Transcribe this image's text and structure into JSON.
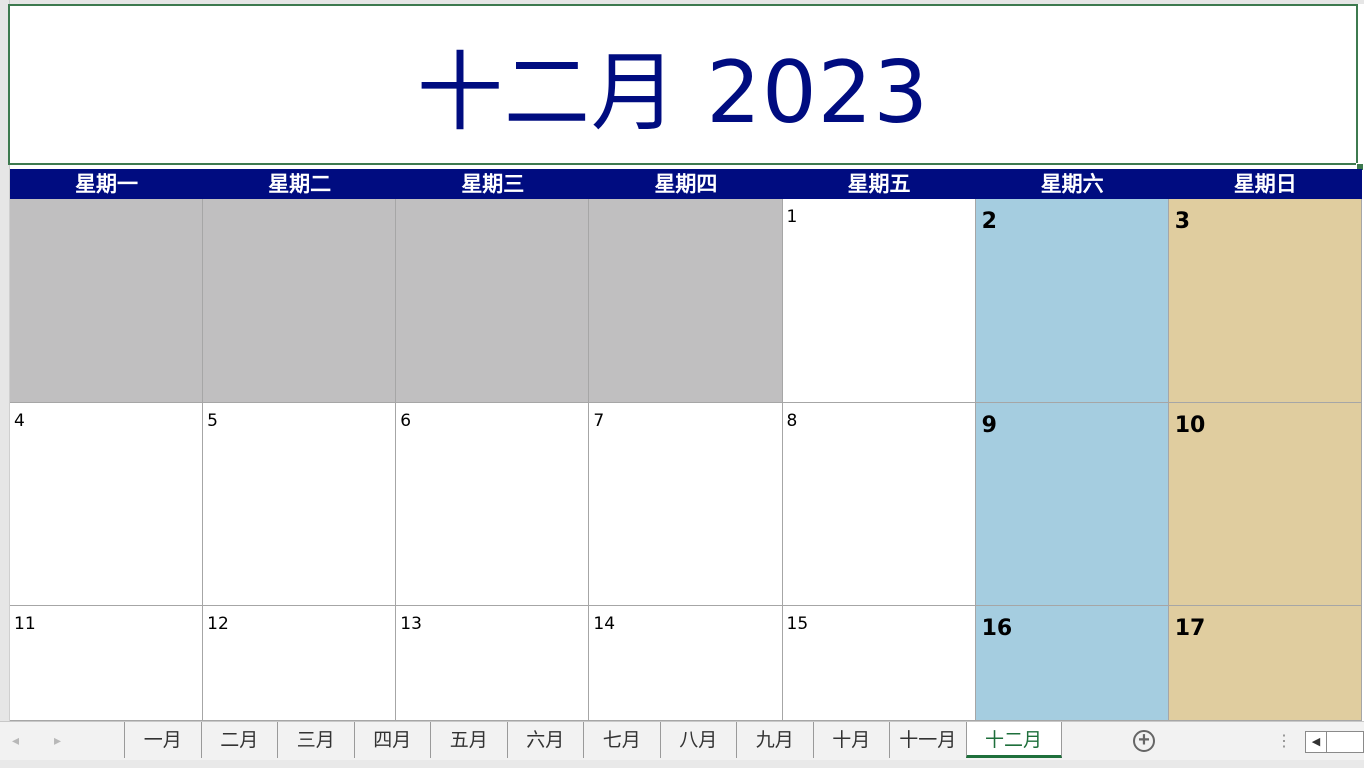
{
  "title": "十二月 2023",
  "weekdays": [
    "星期一",
    "星期二",
    "星期三",
    "星期四",
    "星期五",
    "星期六",
    "星期日"
  ],
  "weeks": [
    [
      "",
      "",
      "",
      "",
      "1",
      "2",
      "3"
    ],
    [
      "4",
      "5",
      "6",
      "7",
      "8",
      "9",
      "10"
    ],
    [
      "11",
      "12",
      "13",
      "14",
      "15",
      "16",
      "17"
    ]
  ],
  "sheet_tabs": [
    "一月",
    "二月",
    "三月",
    "四月",
    "五月",
    "六月",
    "七月",
    "八月",
    "九月",
    "十月",
    "十一月",
    "十二月"
  ],
  "active_tab": "十二月",
  "icons": {
    "prev_sheet": "◂",
    "next_sheet": "▸",
    "add_sheet": "+",
    "more": "⋮",
    "scroll_left": "◀"
  },
  "colors": {
    "title": "#000c80",
    "header_bg": "#000c80",
    "empty_cell": "#c0bfc0",
    "saturday": "#a5cde0",
    "sunday": "#e0cd9f",
    "active_tab": "#1e6f3b"
  }
}
